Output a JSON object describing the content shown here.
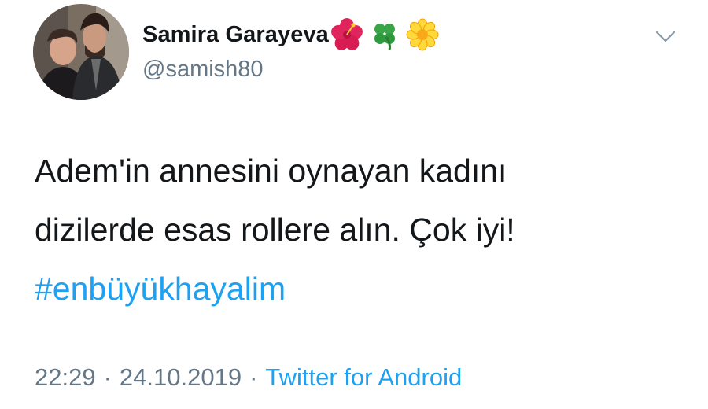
{
  "author": {
    "display_name": "Samira Garayeva",
    "name_emojis": [
      "hibiscus-icon",
      "four-leaf-clover-icon",
      "blossom-icon"
    ],
    "handle": "@samish80"
  },
  "tweet": {
    "text_lines": [
      "Adem'in annesini oynayan kadını",
      "dizilerde esas rollere alın. Çok iyi!"
    ],
    "hashtag": "#enbüyükhayalim"
  },
  "meta": {
    "time": "22:29",
    "separator": "·",
    "date": "24.10.2019",
    "source": "Twitter for Android"
  },
  "colors": {
    "text": "#14171a",
    "secondary": "#657786",
    "link": "#1da1f2"
  }
}
